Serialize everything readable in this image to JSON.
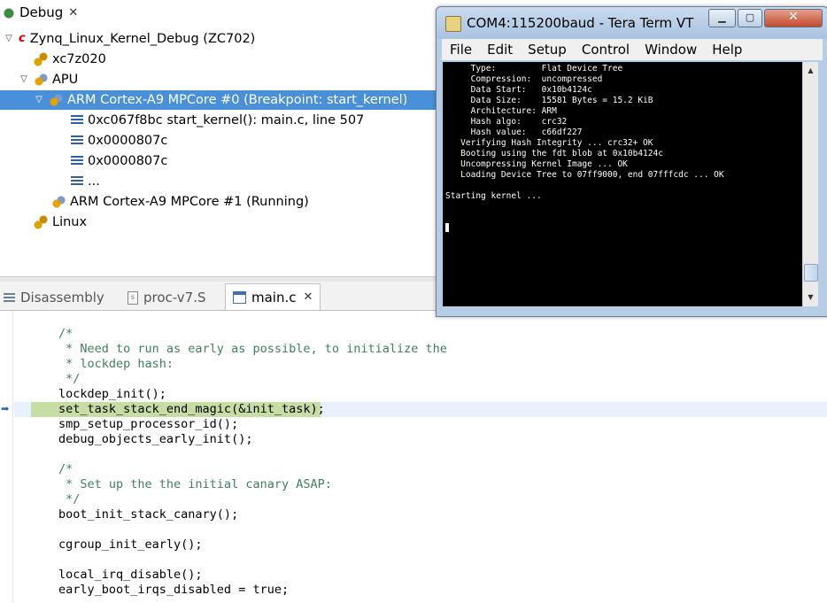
{
  "debug_view": {
    "tab_label": "Debug",
    "launch": "Zynq_Linux_Kernel_Debug (ZC702)",
    "target": "xc7z020",
    "apu": "APU",
    "core0": "ARM Cortex-A9 MPCore #0 (Breakpoint: start_kernel)",
    "frames": [
      "0xc067f8bc start_kernel(): main.c, line 507",
      "0x0000807c",
      "0x0000807c",
      "..."
    ],
    "core1": "ARM Cortex-A9 MPCore #1 (Running)",
    "linux": "Linux"
  },
  "editor_tabs": [
    {
      "label": "Disassembly",
      "icon": "disassembly-icon"
    },
    {
      "label": "proc-v7.S",
      "icon": "asm-file-icon"
    },
    {
      "label": "main.c",
      "icon": "c-file-icon",
      "active": true
    }
  ],
  "code": [
    "/*",
    " * Need to run as early as possible, to initialize the",
    " * lockdep hash:",
    " */",
    "lockdep_init();",
    "set_task_stack_end_magic(&init_task);",
    "smp_setup_processor_id();",
    "debug_objects_early_init();",
    "",
    "/*",
    " * Set up the the initial canary ASAP:",
    " */",
    "boot_init_stack_canary();",
    "",
    "cgroup_init_early();",
    "",
    "local_irq_disable();",
    "early_boot_irqs_disabled = true;"
  ],
  "teraterm": {
    "title": "COM4:115200baud - Tera Term VT",
    "menu": [
      "File",
      "Edit",
      "Setup",
      "Control",
      "Window",
      "Help"
    ],
    "lines": [
      "     Type:         Flat Device Tree",
      "     Compression:  uncompressed",
      "     Data Start:   0x10b4124c",
      "     Data Size:    15581 Bytes = 15.2 KiB",
      "     Architecture: ARM",
      "     Hash algo:    crc32",
      "     Hash value:   c66df227",
      "   Verifying Hash Integrity ... crc32+ OK",
      "   Booting using the fdt blob at 0x10b4124c",
      "   Uncompressing Kernel Image ... OK",
      "   Loading Device Tree to 07ff9000, end 07fffcdc ... OK",
      "",
      "Starting kernel ..."
    ]
  },
  "colors": {
    "selection": "#4a90d9",
    "exec_highlight": "#c6dea3",
    "comment": "#3f7f5f"
  }
}
